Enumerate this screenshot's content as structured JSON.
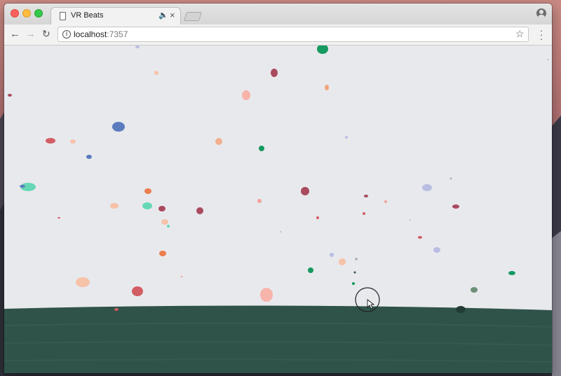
{
  "window": {
    "tab_title": "VR Beats"
  },
  "toolbar": {
    "url_host": "localhost",
    "url_port": ":7357"
  },
  "icons": {
    "tab_page": "document-icon",
    "audio": "speaker-icon",
    "close": "close-icon",
    "profile": "profile-icon",
    "back": "back-arrow-icon",
    "forward": "forward-arrow-icon",
    "reload": "reload-icon",
    "info": "info-icon",
    "bookmark": "star-icon",
    "menu": "kebab-menu-icon"
  },
  "colors": {
    "sky": "#e8e9ed",
    "ground": "#2f5349",
    "ground_light": "#3a6154",
    "red": "#a94a5e",
    "rose": "#d25d64",
    "salmon": "#f6a39e",
    "peach": "#f2b08c",
    "orange": "#ec7d4d",
    "green": "#159a5f",
    "mint": "#66d7b5",
    "blue": "#5a7cbf",
    "lavender": "#b9bde3",
    "gray": "#b0b4c0"
  }
}
